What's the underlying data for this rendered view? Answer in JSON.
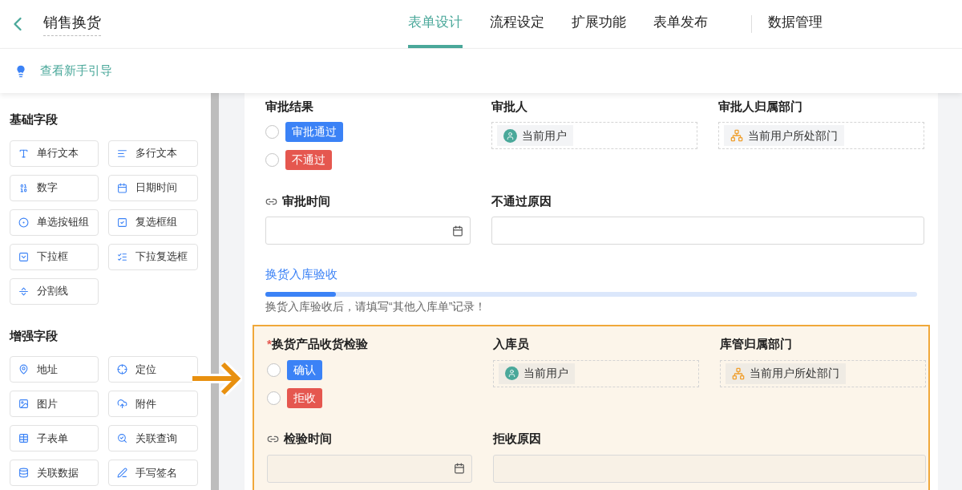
{
  "header": {
    "title": "销售换货",
    "tabs": [
      {
        "label": "表单设计",
        "selected": true
      },
      {
        "label": "流程设定",
        "selected": false
      },
      {
        "label": "扩展功能",
        "selected": false
      },
      {
        "label": "表单发布",
        "selected": false
      },
      {
        "label": "数据管理",
        "selected": false,
        "separated": true
      }
    ]
  },
  "guide": {
    "text": "查看新手引导"
  },
  "sidebar": {
    "groups": [
      {
        "title": "基础字段",
        "items": [
          {
            "label": "单行文本",
            "kind": "single"
          },
          {
            "label": "多行文本",
            "kind": "multi"
          },
          {
            "label": "数字",
            "kind": "number"
          },
          {
            "label": "日期时间",
            "kind": "date"
          },
          {
            "label": "单选按钮组",
            "kind": "radio"
          },
          {
            "label": "复选框组",
            "kind": "checkbox"
          },
          {
            "label": "下拉框",
            "kind": "select"
          },
          {
            "label": "下拉复选框",
            "kind": "multiselect"
          },
          {
            "label": "分割线",
            "kind": "divider"
          }
        ]
      },
      {
        "title": "增强字段",
        "items": [
          {
            "label": "地址",
            "kind": "address"
          },
          {
            "label": "定位",
            "kind": "location"
          },
          {
            "label": "图片",
            "kind": "image"
          },
          {
            "label": "附件",
            "kind": "attachment"
          },
          {
            "label": "子表单",
            "kind": "subform"
          },
          {
            "label": "关联查询",
            "kind": "lookup"
          },
          {
            "label": "关联数据",
            "kind": "relation"
          },
          {
            "label": "手写签名",
            "kind": "signature"
          }
        ]
      }
    ]
  },
  "form": {
    "sections": [
      {
        "kind": "fields",
        "highlighted": false,
        "fields": [
          {
            "label": "审批结果",
            "kind": "radio",
            "options": [
              {
                "label": "审批通过",
                "color": "#3b82f6",
                "selected": false
              },
              {
                "label": "不通过",
                "color": "#e5574f",
                "selected": false
              }
            ]
          },
          {
            "label": "审批人",
            "kind": "chip",
            "chip": {
              "text": "当前用户",
              "kind": "user"
            }
          },
          {
            "label": "审批人归属部门",
            "kind": "chip",
            "chip": {
              "text": "当前用户所处部门",
              "kind": "dept"
            }
          },
          {
            "label": "审批时间",
            "kind": "date",
            "linked": true
          },
          {
            "label": "不通过原因",
            "kind": "text"
          }
        ]
      },
      {
        "kind": "divider",
        "title": "换货入库验收",
        "note": "换货入库验收后，请填写“其他入库单”记录！"
      },
      {
        "kind": "fields",
        "highlighted": true,
        "fields": [
          {
            "label": "换货产品收货检验",
            "required_mark": "*",
            "kind": "radio",
            "options": [
              {
                "label": "确认",
                "color": "#3b82f6",
                "selected": false
              },
              {
                "label": "拒收",
                "color": "#e5574f",
                "selected": false
              }
            ]
          },
          {
            "label": "入库员",
            "kind": "chip",
            "chip": {
              "text": "当前用户",
              "kind": "user"
            }
          },
          {
            "label": "库管归属部门",
            "kind": "chip",
            "chip": {
              "text": "当前用户所处部门",
              "kind": "dept"
            }
          },
          {
            "label": "检验时间",
            "kind": "date",
            "linked": true
          },
          {
            "label": "拒收原因",
            "kind": "text"
          }
        ]
      }
    ]
  }
}
